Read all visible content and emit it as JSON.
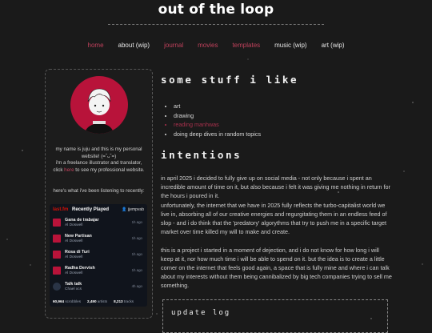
{
  "site_title": "out of the loop",
  "nav": [
    {
      "label": "home",
      "active": true
    },
    {
      "label": "about (wip)",
      "active": false
    },
    {
      "label": "journal",
      "active": true
    },
    {
      "label": "movies",
      "active": true
    },
    {
      "label": "templates",
      "active": true
    },
    {
      "label": "music (wip)",
      "active": false
    },
    {
      "label": "art (wip)",
      "active": false
    }
  ],
  "colors": {
    "accent": "#c0415c",
    "avatar_bg": "#b8133a",
    "background": "#1a1a1a"
  },
  "profile": {
    "bio_line1": "my name is juju and this is my personal",
    "bio_line2": "website! (=ˆᴗˆ=)",
    "bio_line3": "i'm a freelance illustrator and translator,",
    "bio_click": "click",
    "bio_here": "here",
    "bio_rest": "to see my professional website.",
    "listening": "here's what i've been listening to recently:"
  },
  "lastfm": {
    "brand": "last.fm",
    "heading": "Recently Played",
    "user": "jjempvab",
    "tracks": [
      {
        "name": "Gana de trabajar",
        "artist": "Al Doswell",
        "when": "1h ago"
      },
      {
        "name": "New Partisan",
        "artist": "Al Doswell",
        "when": "1h ago"
      },
      {
        "name": "Rosa di Turi",
        "artist": "Al Doswell",
        "when": "1h ago"
      },
      {
        "name": "Radha Dervish",
        "artist": "Al Doswell",
        "when": "1h ago"
      },
      {
        "name": "Talk talk",
        "artist": "Chael xcs",
        "when": "4h ago"
      }
    ],
    "stats": [
      {
        "value": "60,964",
        "label": "scrobbles"
      },
      {
        "value": "2,490",
        "label": "artists"
      },
      {
        "value": "8,213",
        "label": "tracks"
      }
    ]
  },
  "sections": {
    "likes_heading": "some stuff i like",
    "likes": [
      {
        "text": "art",
        "link": false
      },
      {
        "text": "drawing",
        "link": false
      },
      {
        "text": "reading manhwas",
        "link": true
      },
      {
        "text": "doing deep dives in random topics",
        "link": false
      }
    ],
    "intentions_heading": "intentions",
    "intentions_p1": "in april 2025 i decided to fully give up on social media - not only because i spent an incredible amount of time on it, but also because i felt it was giving me nothing in return for the hours i poured in it.",
    "intentions_p2": "unfortunately, the internet that we have in 2025 fully reflects the turbo-capitalist world we live in, absorbing all of our creative energies and regurgitating them in an endless feed of slop - and i do think that the 'predatory' algorythms that try to push me in a specific target market over time killed my will to make and create.",
    "intentions_p3": "this is a project i started in a moment of dejection, and i do not know for how long i will keep at it, nor how much time i will be able to spend on it. but the idea is to create a little corner on the internet that feels good again, a space that is fully mine and where i can talk about my interests without them being cannibalized by big tech companies trying to sell me something.",
    "update_heading": "update log"
  }
}
